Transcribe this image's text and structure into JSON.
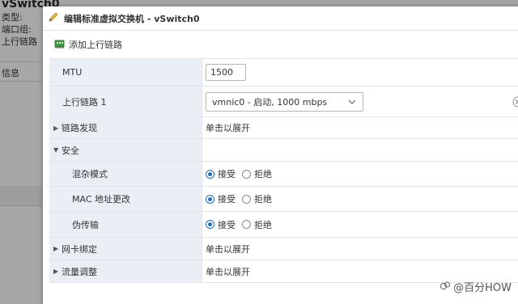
{
  "background": {
    "title": "vSwitch0",
    "lines": [
      "类型:",
      "端口组:",
      "上行链路"
    ],
    "section": "信息"
  },
  "dialog": {
    "title": "编辑标准虚拟交换机 - vSwitch0",
    "add_uplink_label": "添加上行链路"
  },
  "form": {
    "mtu": {
      "label": "MTU",
      "value": "1500"
    },
    "uplink1": {
      "label": "上行链路 1",
      "selected": "vmnic0 - 启动, 1000 mbps"
    },
    "link_discovery": {
      "label": "链路发现",
      "value": "单击以展开"
    },
    "security": {
      "label": "安全",
      "promiscuous": {
        "label": "混杂模式",
        "accept": "接受",
        "reject": "拒绝",
        "selected": "接受"
      },
      "mac_change": {
        "label": "MAC 地址更改",
        "accept": "接受",
        "reject": "拒绝",
        "selected": "接受"
      },
      "forged": {
        "label": "伪传输",
        "accept": "接受",
        "reject": "拒绝",
        "selected": "接受"
      }
    },
    "nic_teaming": {
      "label": "网卡绑定",
      "value": "单击以展开"
    },
    "traffic_shaping": {
      "label": "流量调整",
      "value": "单击以展开"
    }
  },
  "watermark": {
    "text": "@百分HOW"
  },
  "colors": {
    "label_bg": "#e9eff5",
    "accent": "#1d6fb8",
    "overlay": "#a7a7a7"
  }
}
